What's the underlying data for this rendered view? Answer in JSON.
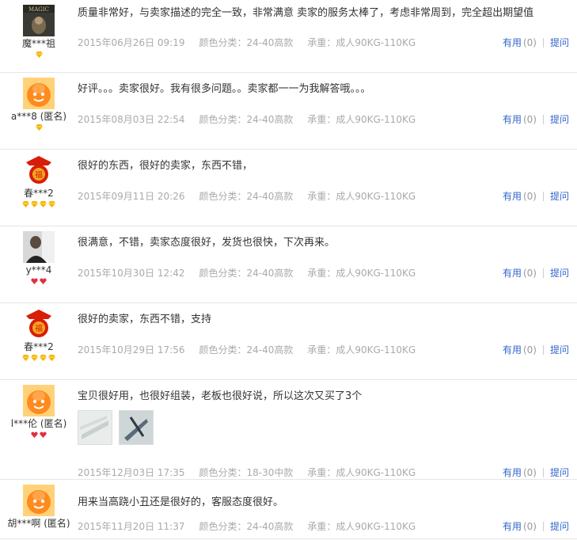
{
  "reviews": [
    {
      "user": "魔***祖",
      "avatar": "magic-photo-avatar",
      "rank": {
        "gem": "diamond-gold",
        "count": 1
      },
      "text": "质量非常好，与卖家描述的完全一致，非常满意 卖家的服务太棒了，考虑非常周到，完全超出期望值",
      "date": "2015年06月26日 09:19",
      "color": "颜色分类：24-40高款",
      "weight": "承重：成人90KG-110KG",
      "useful": "有用",
      "count": "(0)",
      "ask": "提问",
      "photos": []
    },
    {
      "user": "a***8 (匿名)",
      "avatar": "anonymous-orange-avatar",
      "rank": {
        "gem": "diamond-gold",
        "count": 1
      },
      "text": "好评。。。卖家很好。我有很多问题。。卖家都一一为我解答哦。。。",
      "date": "2015年08月03日 22:54",
      "color": "颜色分类：24-40高款",
      "weight": "承重：成人90KG-110KG",
      "useful": "有用",
      "count": "(0)",
      "ask": "提问",
      "photos": []
    },
    {
      "user": "春***2",
      "avatar": "spring-festival-avatar",
      "rank": {
        "gem": "diamond-gold",
        "count": 4
      },
      "text": "很好的东西，很好的卖家，东西不错，",
      "date": "2015年09月11日 20:26",
      "color": "颜色分类：24-40高款",
      "weight": "承重：成人90KG-110KG",
      "useful": "有用",
      "count": "(0)",
      "ask": "提问",
      "photos": []
    },
    {
      "user": "y***4",
      "avatar": "man-photo-avatar",
      "rank": {
        "gem": "heart-red",
        "count": 2
      },
      "text": "很满意，不错，卖家态度很好，发货也很快，下次再来。",
      "date": "2015年10月30日 12:42",
      "color": "颜色分类：24-40高款",
      "weight": "承重：成人90KG-110KG",
      "useful": "有用",
      "count": "(0)",
      "ask": "提问",
      "photos": []
    },
    {
      "user": "春***2",
      "avatar": "spring-festival-avatar",
      "rank": {
        "gem": "diamond-gold",
        "count": 4
      },
      "text": "很好的卖家，东西不错，支持",
      "date": "2015年10月29日 17:56",
      "color": "颜色分类：24-40高款",
      "weight": "承重：成人90KG-110KG",
      "useful": "有用",
      "count": "(0)",
      "ask": "提问",
      "photos": []
    },
    {
      "user": "l***伦 (匿名)",
      "avatar": "anonymous-orange-avatar",
      "rank": {
        "gem": "heart-red",
        "count": 2
      },
      "text": "宝贝很好用，也很好组装，老板也很好说，所以这次又买了3个",
      "date": "2015年12月03日 17:35",
      "color": "颜色分类：18-30中款",
      "weight": "承重：成人90KG-110KG",
      "useful": "有用",
      "count": "(0)",
      "ask": "提问",
      "photos": [
        "review-photo-1",
        "review-photo-2"
      ]
    },
    {
      "user": "胡***啊 (匿名)",
      "avatar": "anonymous-orange-avatar",
      "rank": {
        "gem": "none",
        "count": 0
      },
      "text": "用来当高跷小丑还是很好的，客服态度很好。",
      "date": "2015年11月20日 11:37",
      "color": "颜色分类：24-40高款",
      "weight": "承重：成人90KG-110KG",
      "useful": "有用",
      "count": "(0)",
      "ask": "提问",
      "photos": []
    }
  ]
}
